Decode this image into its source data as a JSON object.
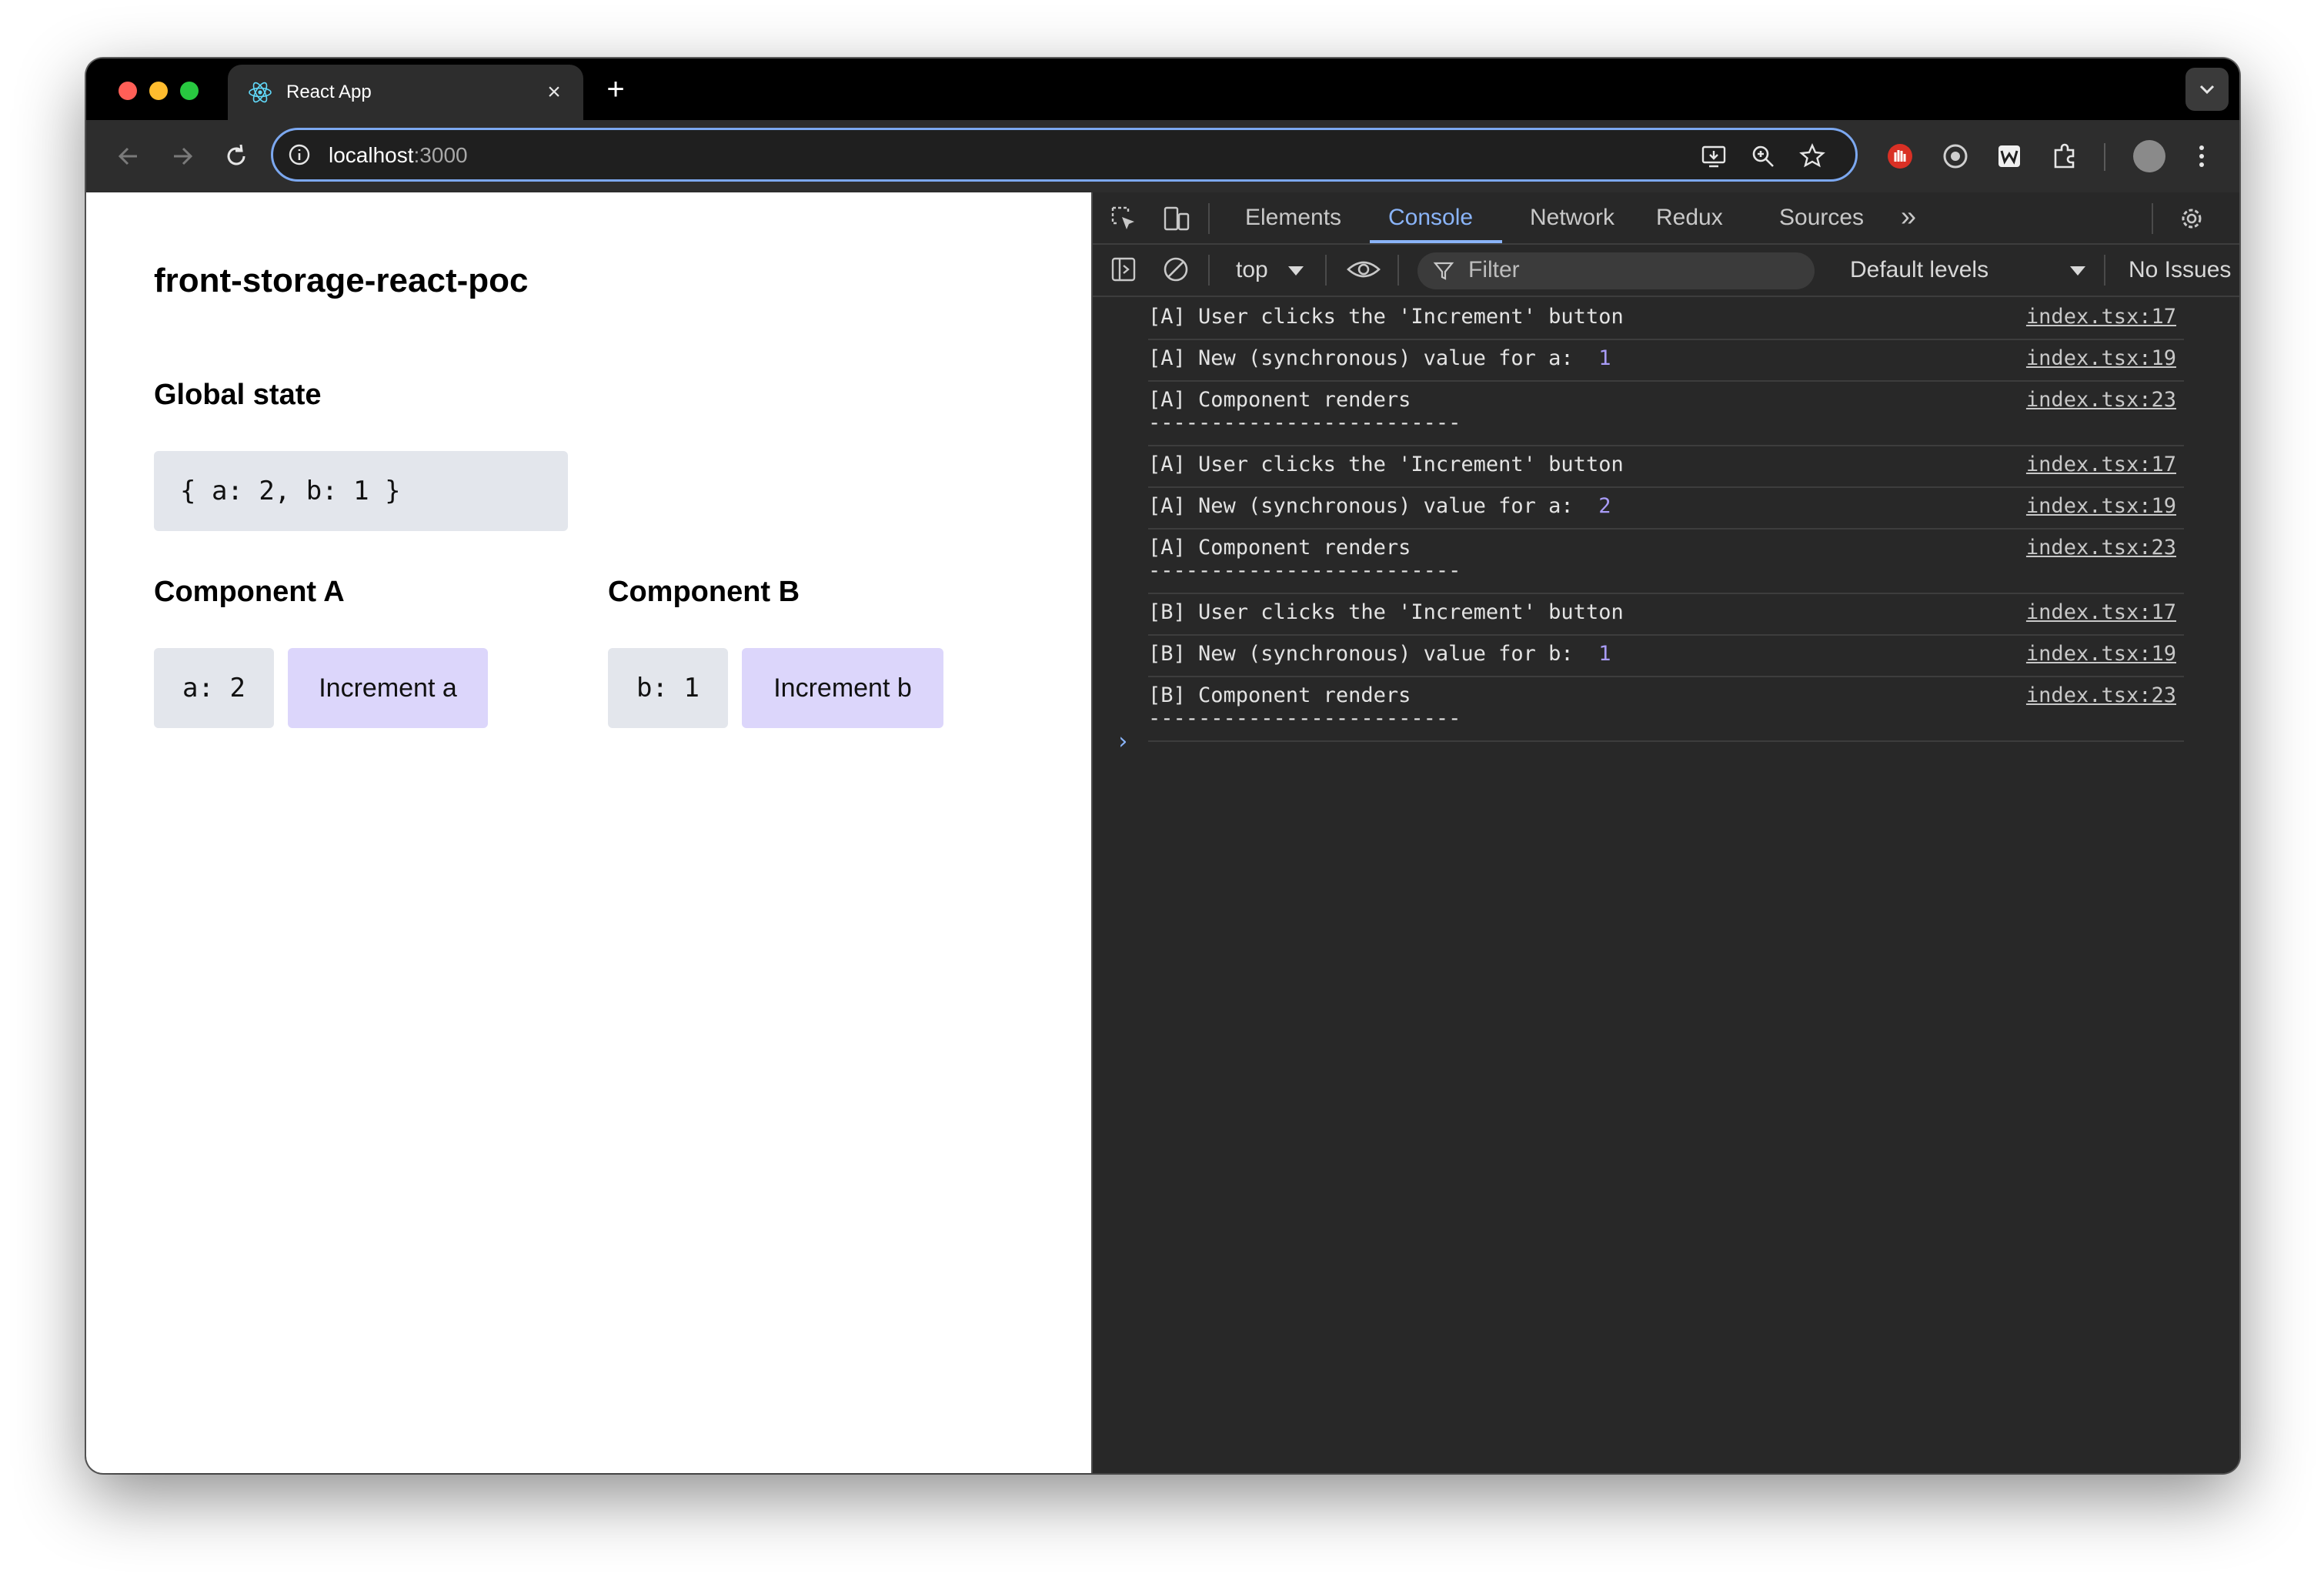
{
  "browser": {
    "tab_title": "React App",
    "tab_close": "×",
    "new_tab": "+",
    "url_host": "localhost",
    "url_port": ":3000"
  },
  "page": {
    "title": "front-storage-react-poc",
    "global_heading": "Global state",
    "global_state_value": "{ a: 2, b: 1 }",
    "component_a": {
      "heading": "Component A",
      "value": "a: 2",
      "button": "Increment a"
    },
    "component_b": {
      "heading": "Component B",
      "value": "b: 1",
      "button": "Increment b"
    }
  },
  "devtools": {
    "tabs": [
      "Elements",
      "Console",
      "Network",
      "Redux",
      "Sources"
    ],
    "active_tab": "Console",
    "more": "»",
    "context": "top",
    "filter_placeholder": "Filter",
    "levels": "Default levels",
    "issues": "No Issues",
    "logs": [
      {
        "text": "[A] User clicks the 'Increment' button",
        "num": "",
        "src": "index.tsx:17",
        "dashes": false
      },
      {
        "text": "[A] New (synchronous) value for a:  ",
        "num": "1",
        "src": "index.tsx:19",
        "dashes": false
      },
      {
        "text": "[A] Component renders",
        "num": "",
        "src": "index.tsx:23",
        "dashes": true
      },
      {
        "text": "[A] User clicks the 'Increment' button",
        "num": "",
        "src": "index.tsx:17",
        "dashes": false
      },
      {
        "text": "[A] New (synchronous) value for a:  ",
        "num": "2",
        "src": "index.tsx:19",
        "dashes": false
      },
      {
        "text": "[A] Component renders",
        "num": "",
        "src": "index.tsx:23",
        "dashes": true
      },
      {
        "text": "[B] User clicks the 'Increment' button",
        "num": "",
        "src": "index.tsx:17",
        "dashes": false
      },
      {
        "text": "[B] New (synchronous) value for b:  ",
        "num": "1",
        "src": "index.tsx:19",
        "dashes": false
      },
      {
        "text": "[B] Component renders",
        "num": "",
        "src": "index.tsx:23",
        "dashes": true
      }
    ],
    "dashes_text": "-------------------------",
    "prompt": "›"
  },
  "colors": {
    "accent": "#8ab4f8",
    "button_purple": "#dcd6fb",
    "code_bg": "#e3e6ec",
    "console_bg": "#282828",
    "log_number": "#a99cf8"
  }
}
